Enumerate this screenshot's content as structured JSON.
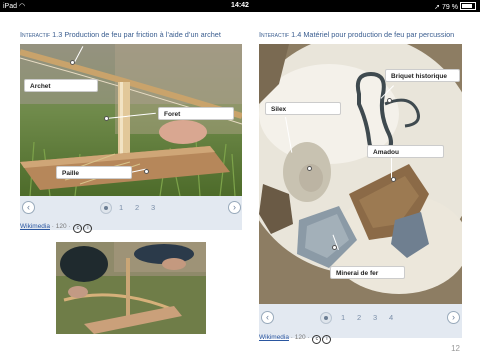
{
  "status": {
    "device": "iPad",
    "time": "14:42",
    "battery": "79 %"
  },
  "widget1": {
    "kind": "Interactif",
    "number": "1.3",
    "title": "Production de feu par friction à l’aide d’un archet",
    "labels": [
      "Archet",
      "Foret",
      "Paille"
    ],
    "pages": [
      "1",
      "2",
      "3"
    ],
    "current_page": 1,
    "source": "Wikimedia",
    "source_suffix": " · 120 · "
  },
  "widget2": {
    "kind": "Interactif",
    "number": "1.4",
    "title": "Matériel pour production de feu par percussion",
    "labels": [
      "Briquet historique",
      "Silex",
      "Amadou",
      "Minerai de fer"
    ],
    "pages": [
      "1",
      "2",
      "3",
      "4"
    ],
    "current_page": 1,
    "source": "Wikimedia",
    "source_suffix": " · 120 · "
  },
  "page_number": "12",
  "icons": {
    "prev": "chevron-left-icon",
    "next": "chevron-right-icon",
    "license": "creative-commons-icon"
  }
}
